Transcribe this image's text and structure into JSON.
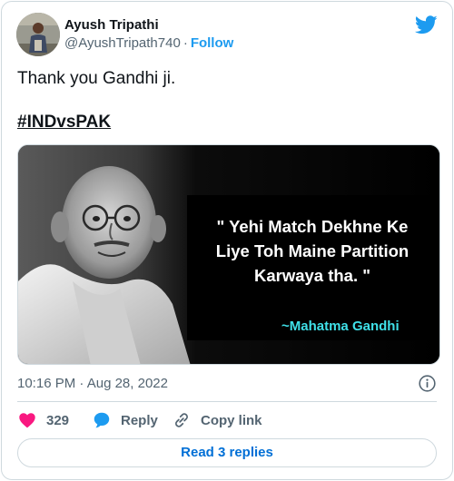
{
  "author": {
    "display_name": "Ayush Tripathi",
    "handle": "@AyushTripath740",
    "separator": "·",
    "follow_label": "Follow"
  },
  "tweet": {
    "text": "Thank you Gandhi ji.",
    "hashtag": "#INDvsPAK"
  },
  "media": {
    "quote_lines": [
      "\" Yehi Match Dekhne Ke",
      "Liye Toh Maine Partition",
      "Karwaya tha. \""
    ],
    "attribution": "~Mahatma Gandhi"
  },
  "meta": {
    "time": "10:16 PM",
    "separator": "·",
    "date": "Aug 28, 2022"
  },
  "actions": {
    "like_count": "329",
    "reply_label": "Reply",
    "copy_label": "Copy link"
  },
  "footer": {
    "read_replies_label": "Read 3 replies"
  },
  "colors": {
    "brand_blue": "#1d9bf0",
    "like_pink": "#f91880",
    "muted_text": "#536471",
    "border": "#cfd9de",
    "quote_cyan": "#3fe0e8"
  },
  "icons": {
    "brand": "twitter-bird-icon",
    "info": "info-icon",
    "like": "heart-icon",
    "reply": "speech-bubble-icon",
    "copy": "link-icon"
  }
}
